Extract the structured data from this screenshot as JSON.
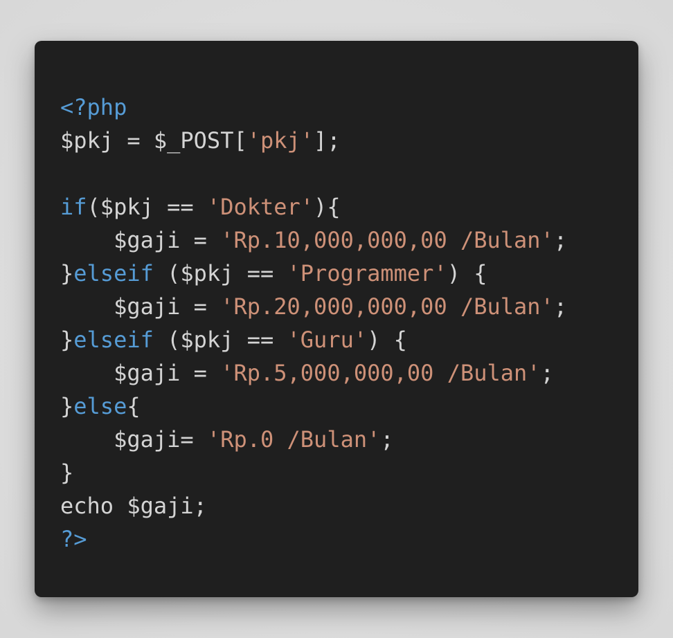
{
  "colors": {
    "background": "#1f1f1f",
    "keyword": "#569cd6",
    "string": "#ce9178",
    "plain": "#d4d4d4"
  },
  "code_lines": [
    [
      {
        "t": "kw",
        "v": "<?php"
      }
    ],
    [
      {
        "t": "plain",
        "v": "$pkj = $_POST["
      },
      {
        "t": "str",
        "v": "'pkj'"
      },
      {
        "t": "plain",
        "v": "];"
      }
    ],
    [],
    [
      {
        "t": "kw",
        "v": "if"
      },
      {
        "t": "plain",
        "v": "($pkj == "
      },
      {
        "t": "str",
        "v": "'Dokter'"
      },
      {
        "t": "plain",
        "v": "){"
      }
    ],
    [
      {
        "t": "plain",
        "v": "    $gaji = "
      },
      {
        "t": "str",
        "v": "'Rp.10,000,000,00 /Bulan'"
      },
      {
        "t": "plain",
        "v": ";"
      }
    ],
    [
      {
        "t": "plain",
        "v": "}"
      },
      {
        "t": "kw",
        "v": "elseif"
      },
      {
        "t": "plain",
        "v": " ($pkj == "
      },
      {
        "t": "str",
        "v": "'Programmer'"
      },
      {
        "t": "plain",
        "v": ") {"
      }
    ],
    [
      {
        "t": "plain",
        "v": "    $gaji = "
      },
      {
        "t": "str",
        "v": "'Rp.20,000,000,00 /Bulan'"
      },
      {
        "t": "plain",
        "v": ";"
      }
    ],
    [
      {
        "t": "plain",
        "v": "}"
      },
      {
        "t": "kw",
        "v": "elseif"
      },
      {
        "t": "plain",
        "v": " ($pkj == "
      },
      {
        "t": "str",
        "v": "'Guru'"
      },
      {
        "t": "plain",
        "v": ") {"
      }
    ],
    [
      {
        "t": "plain",
        "v": "    $gaji = "
      },
      {
        "t": "str",
        "v": "'Rp.5,000,000,00 /Bulan'"
      },
      {
        "t": "plain",
        "v": ";"
      }
    ],
    [
      {
        "t": "plain",
        "v": "}"
      },
      {
        "t": "kw",
        "v": "else"
      },
      {
        "t": "plain",
        "v": "{"
      }
    ],
    [
      {
        "t": "plain",
        "v": "    $gaji= "
      },
      {
        "t": "str",
        "v": "'Rp.0 /Bulan'"
      },
      {
        "t": "plain",
        "v": ";"
      }
    ],
    [
      {
        "t": "plain",
        "v": "}"
      }
    ],
    [
      {
        "t": "plain",
        "v": "echo $gaji;"
      }
    ],
    [
      {
        "t": "kw",
        "v": "?>"
      }
    ]
  ]
}
